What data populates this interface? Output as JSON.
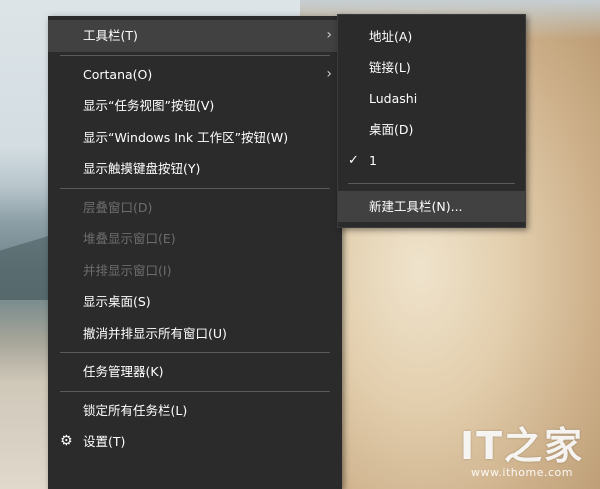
{
  "main_menu": {
    "toolbars": "工具栏(T)",
    "cortana": "Cortana(O)",
    "task_view": "显示“任务视图”按钮(V)",
    "windows_ink": "显示“Windows Ink 工作区”按钮(W)",
    "touch_keyboard": "显示触摸键盘按钮(Y)",
    "cascade": "层叠窗口(D)",
    "stacked": "堆叠显示窗口(E)",
    "side_by_side": "并排显示窗口(I)",
    "show_desktop": "显示桌面(S)",
    "undo_side_by_side": "撤消并排显示所有窗口(U)",
    "task_manager": "任务管理器(K)",
    "lock_taskbars": "锁定所有任务栏(L)",
    "settings": "设置(T)"
  },
  "sub_menu": {
    "address": "地址(A)",
    "links": "链接(L)",
    "ludashi": "Ludashi",
    "desktop": "桌面(D)",
    "one": "1",
    "new_toolbar": "新建工具栏(N)..."
  },
  "icons": {
    "submenu_arrow": "chevron-right-icon",
    "check": "check-icon",
    "settings": "gear-icon"
  },
  "watermark": {
    "logo": "IT之家",
    "url": "www.ithome.com"
  },
  "colors": {
    "menu_bg": "#2b2b2b",
    "menu_highlight": "#414141",
    "menu_text": "#ffffff",
    "menu_disabled_text": "#6d6d6d",
    "separator": "#5a5a5a"
  }
}
